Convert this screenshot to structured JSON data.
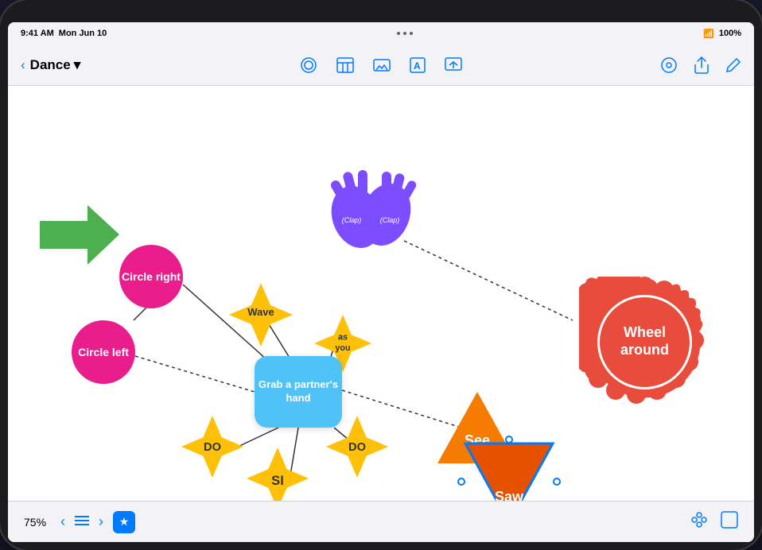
{
  "status_bar": {
    "time": "9:41 AM",
    "date": "Mon Jun 10",
    "dots": "...",
    "wifi": "WiFi",
    "battery": "100%"
  },
  "toolbar": {
    "back_label": "‹",
    "title": "Dance",
    "dropdown_icon": "▾",
    "icons": {
      "shapes": "⬡",
      "table": "▦",
      "media": "⬚",
      "text": "A",
      "image": "⊡",
      "settings": "◎",
      "share": "⬆",
      "edit": "✎"
    }
  },
  "canvas": {
    "nodes": {
      "circle_right": "Circle\nright",
      "circle_left": "Circle\nleft",
      "wave": "Wave",
      "as_you": "as\nyou",
      "do_left": "DO",
      "si": "SI",
      "do_right": "DO",
      "center": "Grab a\npartner's\nhand",
      "clap1": "(Clap)",
      "clap2": "(Clap)",
      "see": "See",
      "saw": "Saw",
      "wheel_around": "Wheel\naround"
    }
  },
  "bottom_bar": {
    "zoom": "75%",
    "back_nav": "‹",
    "list_icon": "≡",
    "forward_nav": "›",
    "star_icon": "★"
  }
}
